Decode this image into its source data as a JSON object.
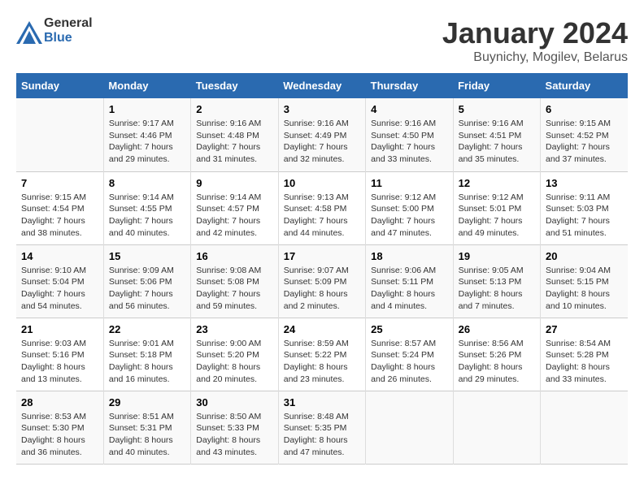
{
  "logo": {
    "general": "General",
    "blue": "Blue"
  },
  "header": {
    "title": "January 2024",
    "subtitle": "Buynichy, Mogilev, Belarus"
  },
  "weekdays": [
    "Sunday",
    "Monday",
    "Tuesday",
    "Wednesday",
    "Thursday",
    "Friday",
    "Saturday"
  ],
  "weeks": [
    [
      {
        "day": "",
        "sunrise": "",
        "sunset": "",
        "daylight": ""
      },
      {
        "day": "1",
        "sunrise": "Sunrise: 9:17 AM",
        "sunset": "Sunset: 4:46 PM",
        "daylight": "Daylight: 7 hours and 29 minutes."
      },
      {
        "day": "2",
        "sunrise": "Sunrise: 9:16 AM",
        "sunset": "Sunset: 4:48 PM",
        "daylight": "Daylight: 7 hours and 31 minutes."
      },
      {
        "day": "3",
        "sunrise": "Sunrise: 9:16 AM",
        "sunset": "Sunset: 4:49 PM",
        "daylight": "Daylight: 7 hours and 32 minutes."
      },
      {
        "day": "4",
        "sunrise": "Sunrise: 9:16 AM",
        "sunset": "Sunset: 4:50 PM",
        "daylight": "Daylight: 7 hours and 33 minutes."
      },
      {
        "day": "5",
        "sunrise": "Sunrise: 9:16 AM",
        "sunset": "Sunset: 4:51 PM",
        "daylight": "Daylight: 7 hours and 35 minutes."
      },
      {
        "day": "6",
        "sunrise": "Sunrise: 9:15 AM",
        "sunset": "Sunset: 4:52 PM",
        "daylight": "Daylight: 7 hours and 37 minutes."
      }
    ],
    [
      {
        "day": "7",
        "sunrise": "Sunrise: 9:15 AM",
        "sunset": "Sunset: 4:54 PM",
        "daylight": "Daylight: 7 hours and 38 minutes."
      },
      {
        "day": "8",
        "sunrise": "Sunrise: 9:14 AM",
        "sunset": "Sunset: 4:55 PM",
        "daylight": "Daylight: 7 hours and 40 minutes."
      },
      {
        "day": "9",
        "sunrise": "Sunrise: 9:14 AM",
        "sunset": "Sunset: 4:57 PM",
        "daylight": "Daylight: 7 hours and 42 minutes."
      },
      {
        "day": "10",
        "sunrise": "Sunrise: 9:13 AM",
        "sunset": "Sunset: 4:58 PM",
        "daylight": "Daylight: 7 hours and 44 minutes."
      },
      {
        "day": "11",
        "sunrise": "Sunrise: 9:12 AM",
        "sunset": "Sunset: 5:00 PM",
        "daylight": "Daylight: 7 hours and 47 minutes."
      },
      {
        "day": "12",
        "sunrise": "Sunrise: 9:12 AM",
        "sunset": "Sunset: 5:01 PM",
        "daylight": "Daylight: 7 hours and 49 minutes."
      },
      {
        "day": "13",
        "sunrise": "Sunrise: 9:11 AM",
        "sunset": "Sunset: 5:03 PM",
        "daylight": "Daylight: 7 hours and 51 minutes."
      }
    ],
    [
      {
        "day": "14",
        "sunrise": "Sunrise: 9:10 AM",
        "sunset": "Sunset: 5:04 PM",
        "daylight": "Daylight: 7 hours and 54 minutes."
      },
      {
        "day": "15",
        "sunrise": "Sunrise: 9:09 AM",
        "sunset": "Sunset: 5:06 PM",
        "daylight": "Daylight: 7 hours and 56 minutes."
      },
      {
        "day": "16",
        "sunrise": "Sunrise: 9:08 AM",
        "sunset": "Sunset: 5:08 PM",
        "daylight": "Daylight: 7 hours and 59 minutes."
      },
      {
        "day": "17",
        "sunrise": "Sunrise: 9:07 AM",
        "sunset": "Sunset: 5:09 PM",
        "daylight": "Daylight: 8 hours and 2 minutes."
      },
      {
        "day": "18",
        "sunrise": "Sunrise: 9:06 AM",
        "sunset": "Sunset: 5:11 PM",
        "daylight": "Daylight: 8 hours and 4 minutes."
      },
      {
        "day": "19",
        "sunrise": "Sunrise: 9:05 AM",
        "sunset": "Sunset: 5:13 PM",
        "daylight": "Daylight: 8 hours and 7 minutes."
      },
      {
        "day": "20",
        "sunrise": "Sunrise: 9:04 AM",
        "sunset": "Sunset: 5:15 PM",
        "daylight": "Daylight: 8 hours and 10 minutes."
      }
    ],
    [
      {
        "day": "21",
        "sunrise": "Sunrise: 9:03 AM",
        "sunset": "Sunset: 5:16 PM",
        "daylight": "Daylight: 8 hours and 13 minutes."
      },
      {
        "day": "22",
        "sunrise": "Sunrise: 9:01 AM",
        "sunset": "Sunset: 5:18 PM",
        "daylight": "Daylight: 8 hours and 16 minutes."
      },
      {
        "day": "23",
        "sunrise": "Sunrise: 9:00 AM",
        "sunset": "Sunset: 5:20 PM",
        "daylight": "Daylight: 8 hours and 20 minutes."
      },
      {
        "day": "24",
        "sunrise": "Sunrise: 8:59 AM",
        "sunset": "Sunset: 5:22 PM",
        "daylight": "Daylight: 8 hours and 23 minutes."
      },
      {
        "day": "25",
        "sunrise": "Sunrise: 8:57 AM",
        "sunset": "Sunset: 5:24 PM",
        "daylight": "Daylight: 8 hours and 26 minutes."
      },
      {
        "day": "26",
        "sunrise": "Sunrise: 8:56 AM",
        "sunset": "Sunset: 5:26 PM",
        "daylight": "Daylight: 8 hours and 29 minutes."
      },
      {
        "day": "27",
        "sunrise": "Sunrise: 8:54 AM",
        "sunset": "Sunset: 5:28 PM",
        "daylight": "Daylight: 8 hours and 33 minutes."
      }
    ],
    [
      {
        "day": "28",
        "sunrise": "Sunrise: 8:53 AM",
        "sunset": "Sunset: 5:30 PM",
        "daylight": "Daylight: 8 hours and 36 minutes."
      },
      {
        "day": "29",
        "sunrise": "Sunrise: 8:51 AM",
        "sunset": "Sunset: 5:31 PM",
        "daylight": "Daylight: 8 hours and 40 minutes."
      },
      {
        "day": "30",
        "sunrise": "Sunrise: 8:50 AM",
        "sunset": "Sunset: 5:33 PM",
        "daylight": "Daylight: 8 hours and 43 minutes."
      },
      {
        "day": "31",
        "sunrise": "Sunrise: 8:48 AM",
        "sunset": "Sunset: 5:35 PM",
        "daylight": "Daylight: 8 hours and 47 minutes."
      },
      {
        "day": "",
        "sunrise": "",
        "sunset": "",
        "daylight": ""
      },
      {
        "day": "",
        "sunrise": "",
        "sunset": "",
        "daylight": ""
      },
      {
        "day": "",
        "sunrise": "",
        "sunset": "",
        "daylight": ""
      }
    ]
  ]
}
